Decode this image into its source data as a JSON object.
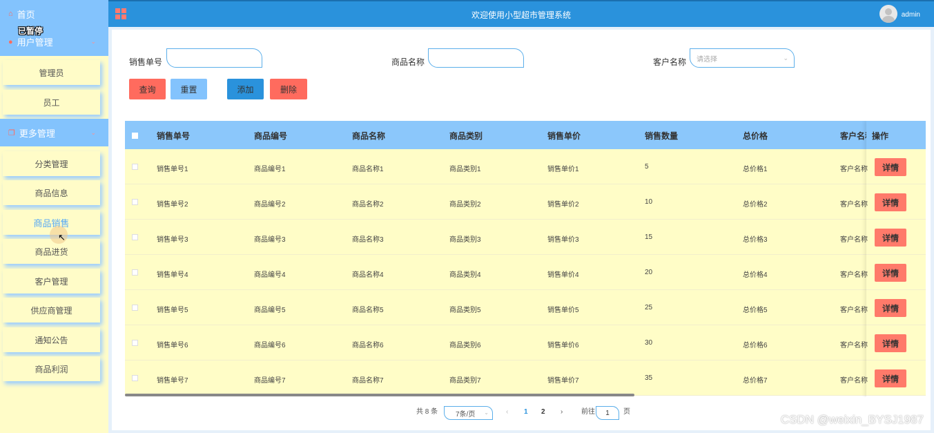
{
  "sidebar": {
    "home": "首页",
    "group_user": "用户管理",
    "user_items": [
      "管理员",
      "员工"
    ],
    "group_more": "更多管理",
    "more_items": [
      "分类管理",
      "商品信息",
      "商品销售",
      "商品进货",
      "客户管理",
      "供应商管理",
      "通知公告",
      "商品利润"
    ],
    "active_item": "商品销售",
    "overlay_text": "已暂停"
  },
  "topbar": {
    "title": "欢迎使用小型超市管理系统",
    "user": "admin"
  },
  "filters": {
    "sale_no_label": "销售单号",
    "sale_no_value": "",
    "product_name_label": "商品名称",
    "product_name_value": "",
    "customer_label": "客户名称",
    "customer_placeholder": "请选择"
  },
  "buttons": {
    "query": "查询",
    "reset": "重置",
    "add": "添加",
    "delete": "删除"
  },
  "table": {
    "columns": [
      "销售单号",
      "商品编号",
      "商品名称",
      "商品类别",
      "销售单价",
      "销售数量",
      "总价格",
      "客户名称",
      "操作"
    ],
    "rows": [
      [
        "销售单号1",
        "商品编号1",
        "商品名称1",
        "商品类别1",
        "销售单价1",
        "5",
        "总价格1",
        "客户名称"
      ],
      [
        "销售单号2",
        "商品编号2",
        "商品名称2",
        "商品类别2",
        "销售单价2",
        "10",
        "总价格2",
        "客户名称"
      ],
      [
        "销售单号3",
        "商品编号3",
        "商品名称3",
        "商品类别3",
        "销售单价3",
        "15",
        "总价格3",
        "客户名称"
      ],
      [
        "销售单号4",
        "商品编号4",
        "商品名称4",
        "商品类别4",
        "销售单价4",
        "20",
        "总价格4",
        "客户名称"
      ],
      [
        "销售单号5",
        "商品编号5",
        "商品名称5",
        "商品类别5",
        "销售单价5",
        "25",
        "总价格5",
        "客户名称"
      ],
      [
        "销售单号6",
        "商品编号6",
        "商品名称6",
        "商品类别6",
        "销售单价6",
        "30",
        "总价格6",
        "客户名称"
      ],
      [
        "销售单号7",
        "商品编号7",
        "商品名称7",
        "商品类别7",
        "销售单价7",
        "35",
        "总价格7",
        "客户名称"
      ]
    ],
    "detail_label": "详情"
  },
  "pagination": {
    "total": "共 8 条",
    "page_size": "7条/页",
    "prev": "‹",
    "pages": [
      "1",
      "2"
    ],
    "current": "1",
    "next": "›",
    "goto_label": "前往",
    "goto_value": "1",
    "page_suffix": "页"
  },
  "watermark": "CSDN @weixin_BYSJ1987",
  "colors": {
    "topbar": "#2a92dc",
    "sidebar_head": "#83c3fd",
    "sidebar_bg": "#fffcc8",
    "row_bg": "#fffdc7",
    "table_head": "#8bc7fb",
    "query_btn": "#ff6b5e",
    "reset_btn": "#83c3fd",
    "add_btn": "#2a92dc",
    "delete_btn": "#ff6b5e",
    "active_text": "#57a9f5"
  }
}
